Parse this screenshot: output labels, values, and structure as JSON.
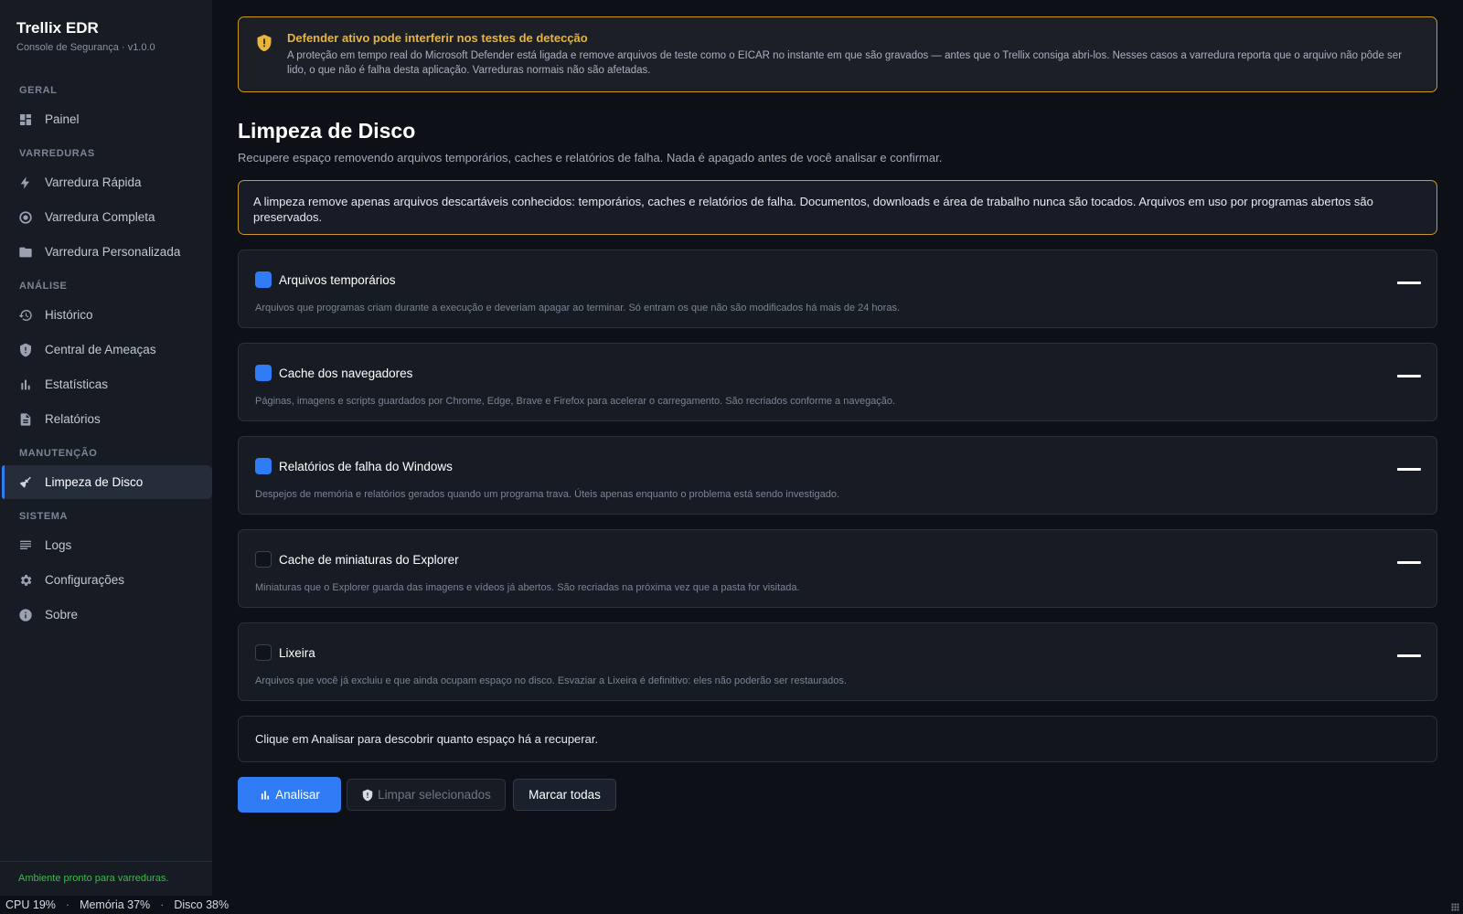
{
  "sidebar": {
    "brand_title": "Trellix EDR",
    "brand_subtitle": "Console de Segurança · v1.0.0",
    "sections": {
      "geral": "GERAL",
      "varreduras": "VARREDURAS",
      "analise": "ANÁLISE",
      "manutencao": "MANUTENÇÃO",
      "sistema": "SISTEMA"
    },
    "items": {
      "painel": "Painel",
      "varredura_rapida": "Varredura Rápida",
      "varredura_completa": "Varredura Completa",
      "varredura_personalizada": "Varredura Personalizada",
      "historico": "Histórico",
      "central_ameacas": "Central de Ameaças",
      "estatisticas": "Estatísticas",
      "relatorios": "Relatórios",
      "limpeza_disco": "Limpeza de Disco",
      "logs": "Logs",
      "configuracoes": "Configurações",
      "sobre": "Sobre"
    },
    "active_item": "limpeza_disco",
    "status": "Ambiente pronto para varreduras."
  },
  "bottombar": {
    "cpu": "CPU 19%",
    "memoria": "Memória 37%",
    "disco": "Disco 38%",
    "separator": "·"
  },
  "warning": {
    "title": "Defender ativo pode interferir nos testes de detecção",
    "text": "A proteção em tempo real do Microsoft Defender está ligada e remove arquivos de teste como o EICAR no instante em que são gravados — antes que o Trellix consiga abri-los. Nesses casos a varredura reporta que o arquivo não pôde ser lido, o que não é falha desta aplicação. Varreduras normais não são afetadas."
  },
  "page": {
    "title": "Limpeza de Disco",
    "subtitle": "Recupere espaço removendo arquivos temporários, caches e relatórios de falha. Nada é apagado antes de você analisar e confirmar.",
    "info": "A limpeza remove apenas arquivos descartáveis conhecidos: temporários, caches e relatórios de falha. Documentos, downloads e área de trabalho nunca são tocados. Arquivos em uso por programas abertos são preservados."
  },
  "options": [
    {
      "label": "Arquivos temporários",
      "checked": true,
      "description": "Arquivos que programas criam durante a execução e deveriam apagar ao terminar. Só entram os que não são modificados há mais de 24 horas.",
      "size": "—"
    },
    {
      "label": "Cache dos navegadores",
      "checked": true,
      "description": "Páginas, imagens e scripts guardados por Chrome, Edge, Brave e Firefox para acelerar o carregamento. São recriados conforme a navegação.",
      "size": "—"
    },
    {
      "label": "Relatórios de falha do Windows",
      "checked": true,
      "description": "Despejos de memória e relatórios gerados quando um programa trava. Úteis apenas enquanto o problema está sendo investigado.",
      "size": "—"
    },
    {
      "label": "Cache de miniaturas do Explorer",
      "checked": false,
      "description": "Miniaturas que o Explorer guarda das imagens e vídeos já abertos. São recriadas na próxima vez que a pasta for visitada.",
      "size": "—"
    },
    {
      "label": "Lixeira",
      "checked": false,
      "description": "Arquivos que você já excluiu e que ainda ocupam espaço no disco. Esvaziar a Lixeira é definitivo: eles não poderão ser restaurados.",
      "size": "—"
    }
  ],
  "result": "Clique em Analisar para descobrir quanto espaço há a recuperar.",
  "actions": {
    "analyze": "Analisar",
    "clean_selected": "Limpar selecionados",
    "select_all": "Marcar todas"
  },
  "colors": {
    "accent": "#2f7cf6",
    "warning": "#c99a1c",
    "warning_title": "#e8b53a",
    "status_ok": "#3fb950",
    "background": "#0d1117",
    "sidebar": "#161b24"
  },
  "icons": {
    "painel": "dashboard-icon",
    "varredura_rapida": "bolt-icon",
    "varredura_completa": "target-icon",
    "varredura_personalizada": "folder-icon",
    "historico": "history-icon",
    "central_ameacas": "shield-alert-icon",
    "estatisticas": "bar-chart-icon",
    "relatorios": "document-icon",
    "limpeza_disco": "broom-icon",
    "logs": "list-icon",
    "configuracoes": "gear-icon",
    "sobre": "info-icon",
    "warning": "shield-alert-icon",
    "analyze": "bar-chart-icon",
    "clean": "shield-alert-icon"
  }
}
